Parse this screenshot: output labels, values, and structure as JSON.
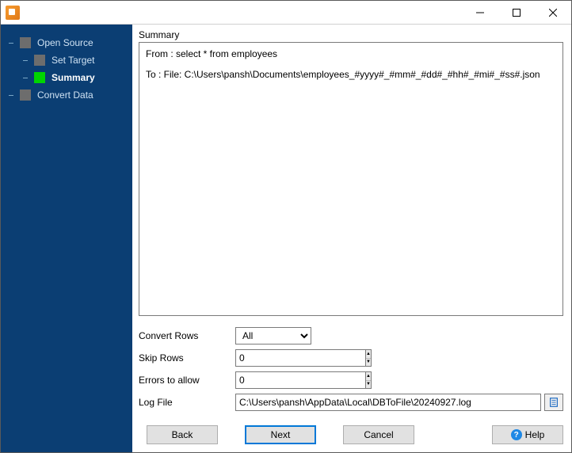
{
  "window": {
    "title": ""
  },
  "sidebar": {
    "items": [
      {
        "label": "Open Source",
        "active": false
      },
      {
        "label": "Set Target",
        "active": false
      },
      {
        "label": "Summary",
        "active": true
      },
      {
        "label": "Convert Data",
        "active": false
      }
    ]
  },
  "main": {
    "summary_heading": "Summary",
    "summary_from": "From : select * from employees",
    "summary_to": "To : File: C:\\Users\\pansh\\Documents\\employees_#yyyy#_#mm#_#dd#_#hh#_#mi#_#ss#.json",
    "convert_rows_label": "Convert Rows",
    "convert_rows_value": "All",
    "convert_rows_options": [
      "All"
    ],
    "skip_rows_label": "Skip Rows",
    "skip_rows_value": "0",
    "errors_label": "Errors to allow",
    "errors_value": "0",
    "logfile_label": "Log File",
    "logfile_value": "C:\\Users\\pansh\\AppData\\Local\\DBToFile\\20240927.log"
  },
  "buttons": {
    "back": "Back",
    "next": "Next",
    "cancel": "Cancel",
    "help": "Help"
  }
}
